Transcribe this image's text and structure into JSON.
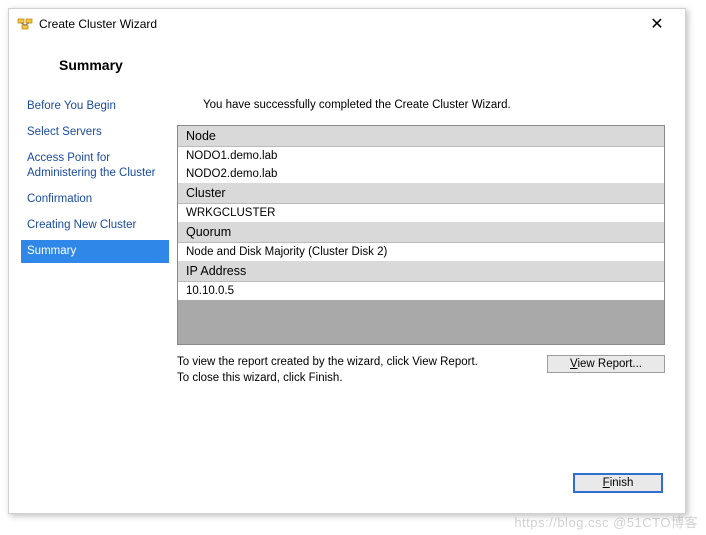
{
  "window": {
    "title": "Create Cluster Wizard",
    "close_glyph": "✕"
  },
  "header": {
    "title": "Summary"
  },
  "sidebar": {
    "items": [
      {
        "label": "Before You Begin"
      },
      {
        "label": "Select Servers"
      },
      {
        "label": "Access Point for Administering the Cluster"
      },
      {
        "label": "Confirmation"
      },
      {
        "label": "Creating New Cluster"
      },
      {
        "label": "Summary"
      }
    ]
  },
  "main": {
    "intro": "You have successfully completed the Create Cluster Wizard.",
    "sections": {
      "node_head": "Node",
      "node_vals": [
        "NODO1.demo.lab",
        "NODO2.demo.lab"
      ],
      "cluster_head": "Cluster",
      "cluster_val": "WRKGCLUSTER",
      "quorum_head": "Quorum",
      "quorum_val": "Node and Disk Majority (Cluster Disk 2)",
      "ip_head": "IP Address",
      "ip_val": "10.10.0.5"
    },
    "hint_line1": "To view the report created by the wizard, click View Report.",
    "hint_line2": "To close this wizard, click Finish.",
    "view_report_pre": "",
    "view_report_u": "V",
    "view_report_post": "iew Report..."
  },
  "footer": {
    "finish": "Finish"
  },
  "watermark": "https://blog.csc @51CTO博客"
}
